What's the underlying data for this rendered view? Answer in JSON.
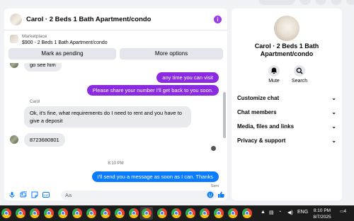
{
  "chat": {
    "title": "Carol · 2 Beds 1 Bath Apartment/condo",
    "info_icon": "info-icon",
    "listing": {
      "label": "Marketplace",
      "price_title": "$900 - 2 Beds 1 Bath Apartment/condo"
    },
    "buttons": {
      "mark_pending": "Mark as pending",
      "more_options": "More options"
    },
    "messages": {
      "partial_top": "go see him",
      "out1": "any time you can visit",
      "out2": "Please share your number I'll get back to you soon.",
      "sender": "Carol",
      "in1": "Ok, it's fine, what requirements do I need to rent and you have to give a deposit",
      "in2": "8723680801",
      "timestamp": "8:10 PM",
      "out3": "I'll send you a message as soon as I can. Thanks",
      "status": "Sent"
    },
    "composer": {
      "placeholder": "Aa"
    }
  },
  "side": {
    "name": "Carol · 2 Beds 1 Bath Apartment/condo",
    "mute_label": "Mute",
    "search_label": "Search",
    "rows": [
      "Customize chat",
      "Chat members",
      "Media, files and links",
      "Privacy & support"
    ]
  },
  "taskbar": {
    "language": "ENG",
    "time": "8:10 PM",
    "date": "8/7/2025",
    "notifications": "4"
  },
  "colors": {
    "accent": "#8a2be2",
    "blue": "#0a7cff",
    "bubble_in": "#e9eaee"
  }
}
